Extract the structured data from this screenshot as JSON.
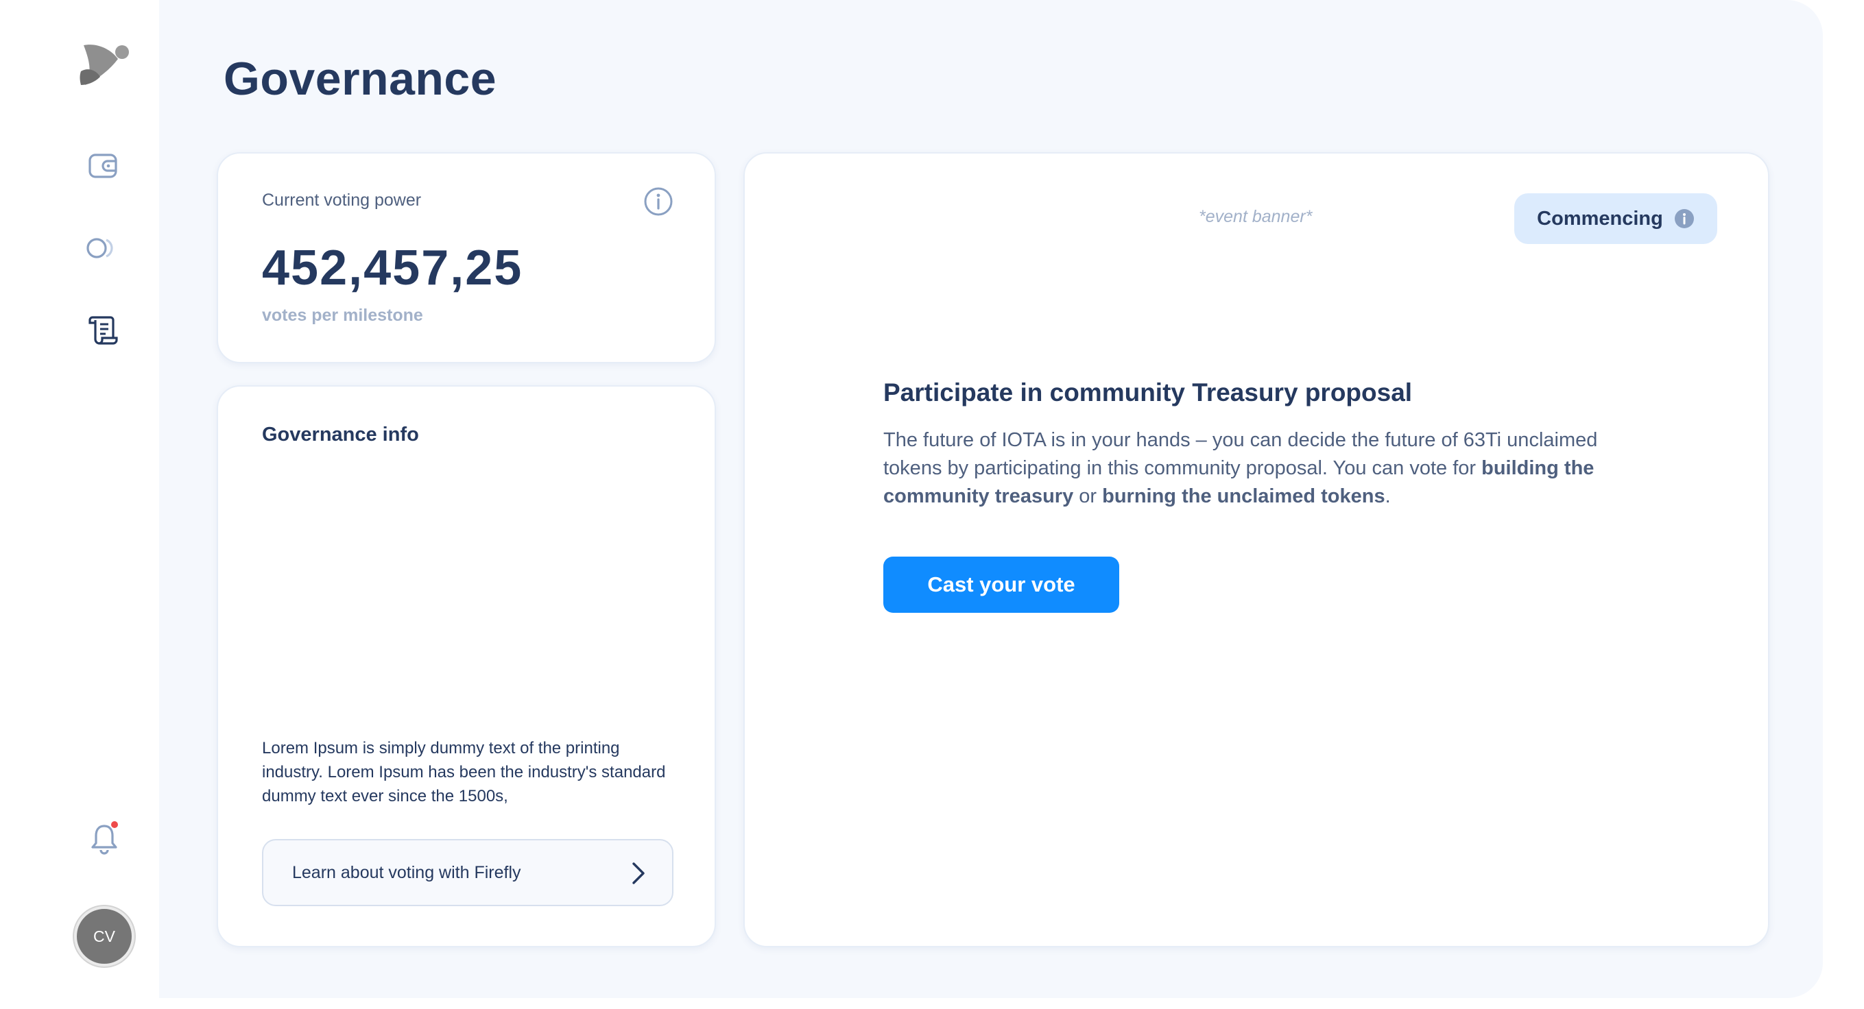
{
  "page": {
    "title": "Governance"
  },
  "sidebar": {
    "items": [
      {
        "name": "wallet",
        "icon": "wallet-icon"
      },
      {
        "name": "collectibles",
        "icon": "toggle-circles-icon"
      },
      {
        "name": "governance",
        "icon": "scroll-icon"
      }
    ],
    "notifications_icon": "bell-icon",
    "has_unread_notification": true,
    "profile_initials": "CV"
  },
  "voting_power": {
    "label": "Current voting power",
    "value": "452,457,25",
    "unit": "votes per milestone"
  },
  "governance_info": {
    "title": "Governance info",
    "body": "Lorem Ipsum is simply dummy text of the printing industry. Lorem Ipsum has been the industry's standard dummy text ever since the 1500s,",
    "link_label": "Learn about voting with Firefly"
  },
  "event": {
    "banner": "*event banner*",
    "status": "Commencing",
    "heading": "Participate in community Treasury proposal",
    "body_intro": "The future of IOTA is in your hands – you can decide the future of 63Ti unclaimed tokens by participating in this community proposal. You can vote for ",
    "option_a": "building the community treasury",
    "body_or": " or ",
    "option_b": "burning the unclaimed tokens",
    "body_end": ".",
    "cta": "Cast your vote"
  },
  "colors": {
    "primary": "#108cff",
    "text": "#25395f",
    "muted": "#a2b1c9",
    "status_bg": "#dcebfd",
    "notification_dot": "#ee4a4a",
    "background": "#f5f8fd"
  }
}
